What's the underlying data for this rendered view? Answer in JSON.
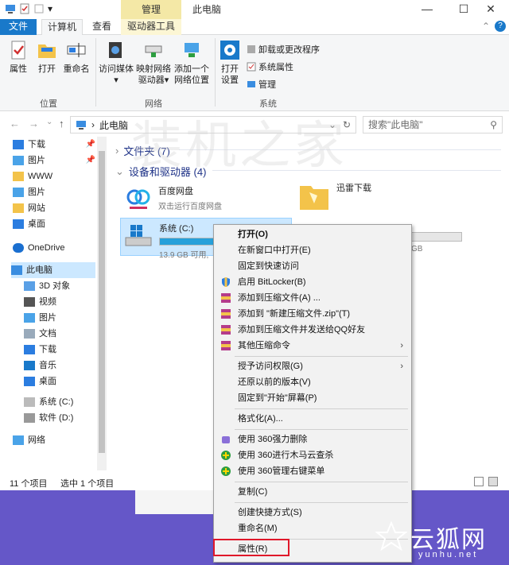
{
  "title_bar": {
    "manage_tab": "管理",
    "window_title": "此电脑",
    "qat_dropdown": "▾",
    "minimize": "—",
    "maximize": "☐",
    "close": "✕"
  },
  "tabs": {
    "file": "文件",
    "computer": "计算机",
    "view": "查看",
    "drive_tools": "驱动器工具"
  },
  "ribbon": {
    "properties": "属性",
    "open": "打开",
    "rename": "重命名",
    "location_group": "位置",
    "access_media": "访问媒体",
    "access_media_arrow": "▾",
    "map_drive_1": "映射网络",
    "map_drive_2": "驱动器",
    "map_drive_arrow": "▾",
    "add_location_1": "添加一个",
    "add_location_2": "网络位置",
    "network_group": "网络",
    "open_settings_1": "打开",
    "open_settings_2": "设置",
    "uninstall": "卸载或更改程序",
    "system_props": "系统属性",
    "manage": "管理",
    "system_group": "系统",
    "collapse": "⌃",
    "help": "?"
  },
  "address": {
    "back": "←",
    "forward": "→",
    "recent": "⌄",
    "up": "↑",
    "path": "此电脑",
    "path_sep": "›",
    "path_dropdown": "⌄",
    "refresh": "↻",
    "search_placeholder": "搜索\"此电脑\"",
    "search_icon": "⚲"
  },
  "nav": {
    "items": [
      {
        "label": "下载"
      },
      {
        "label": "图片"
      },
      {
        "label": "WWW"
      },
      {
        "label": "图片"
      },
      {
        "label": "网站"
      },
      {
        "label": "桌面"
      },
      {
        "label": "OneDrive"
      },
      {
        "label": "此电脑"
      },
      {
        "label": "3D 对象"
      },
      {
        "label": "视频"
      },
      {
        "label": "图片"
      },
      {
        "label": "文档"
      },
      {
        "label": "下载"
      },
      {
        "label": "音乐"
      },
      {
        "label": "桌面"
      },
      {
        "label": "系统 (C:)"
      },
      {
        "label": "软件 (D:)"
      },
      {
        "label": "网络"
      }
    ]
  },
  "content": {
    "folders_header": "文件夹 (7)",
    "devices_header": "设备和驱动器 (4)",
    "drives": [
      {
        "name": "百度网盘",
        "sub": "双击运行百度网盘"
      },
      {
        "name": "迅雷下载",
        "sub": ""
      },
      {
        "name": "系统 (C:)",
        "sub": "13.9 GB 可用,"
      },
      {
        "name": "",
        "sub": "GB"
      }
    ]
  },
  "status": {
    "count": "11 个项目",
    "selected": "选中 1 个项目"
  },
  "watermark": "装机之家",
  "context_menu": {
    "items": [
      {
        "label": "打开(O)"
      },
      {
        "label": "在新窗口中打开(E)"
      },
      {
        "label": "固定到快速访问"
      },
      {
        "label": "启用 BitLocker(B)"
      },
      {
        "label": "添加到压缩文件(A) ..."
      },
      {
        "label": "添加到 \"新建压缩文件.zip\"(T)"
      },
      {
        "label": "添加到压缩文件并发送给QQ好友"
      },
      {
        "label": "其他压缩命令"
      },
      {
        "label": "授予访问权限(G)"
      },
      {
        "label": "还原以前的版本(V)"
      },
      {
        "label": "固定到\"开始\"屏幕(P)"
      },
      {
        "label": "格式化(A)..."
      },
      {
        "label": "使用 360强力删除"
      },
      {
        "label": "使用 360进行木马云查杀"
      },
      {
        "label": "使用 360管理右键菜单"
      },
      {
        "label": "复制(C)"
      },
      {
        "label": "创建快捷方式(S)"
      },
      {
        "label": "重命名(M)"
      },
      {
        "label": "属性(R)"
      }
    ],
    "submenu_arrow": "›"
  },
  "logo": {
    "text": "云狐网",
    "url": "yunhu.net"
  },
  "colors": {
    "accent": "#1979ca",
    "highlight_box": "#e0182a",
    "backdrop": "#6557c8"
  }
}
